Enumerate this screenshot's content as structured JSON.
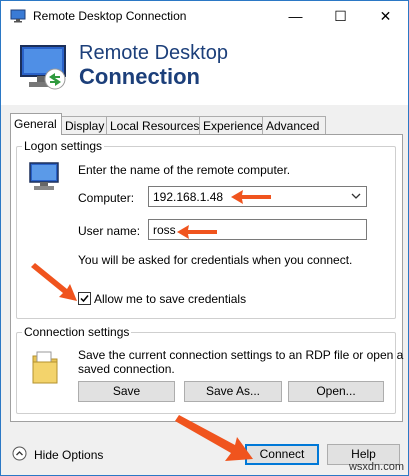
{
  "window": {
    "title": "Remote Desktop Connection",
    "minimize_glyph": "—",
    "maximize_glyph": "☐",
    "close_glyph": "✕"
  },
  "banner": {
    "line1": "Remote Desktop",
    "line2": "Connection"
  },
  "tabs": [
    {
      "label": "General",
      "active": true
    },
    {
      "label": "Display",
      "active": false
    },
    {
      "label": "Local Resources",
      "active": false
    },
    {
      "label": "Experience",
      "active": false
    },
    {
      "label": "Advanced",
      "active": false
    }
  ],
  "logon": {
    "legend": "Logon settings",
    "instruction": "Enter the name of the remote computer.",
    "computer_label": "Computer:",
    "computer_value": "192.168.1.48",
    "username_label": "User name:",
    "username_value": "ross",
    "credentials_note": "You will be asked for credentials when you connect.",
    "save_credentials_label": "Allow me to save credentials",
    "save_credentials_checked": true
  },
  "connection": {
    "legend": "Connection settings",
    "description_line1": "Save the current connection settings to an RDP file or open a",
    "description_line2": "saved connection.",
    "save_label": "Save",
    "save_as_label": "Save As...",
    "open_label": "Open..."
  },
  "footer": {
    "hide_options_label": "Hide Options",
    "connect_label": "Connect",
    "help_label": "Help"
  },
  "watermark": "wsxdn.com",
  "colors": {
    "annotation_arrow": "#f0541e",
    "title_text": "#1c3f7a",
    "window_border": "#2b78c5",
    "default_button_border": "#0078d7"
  }
}
